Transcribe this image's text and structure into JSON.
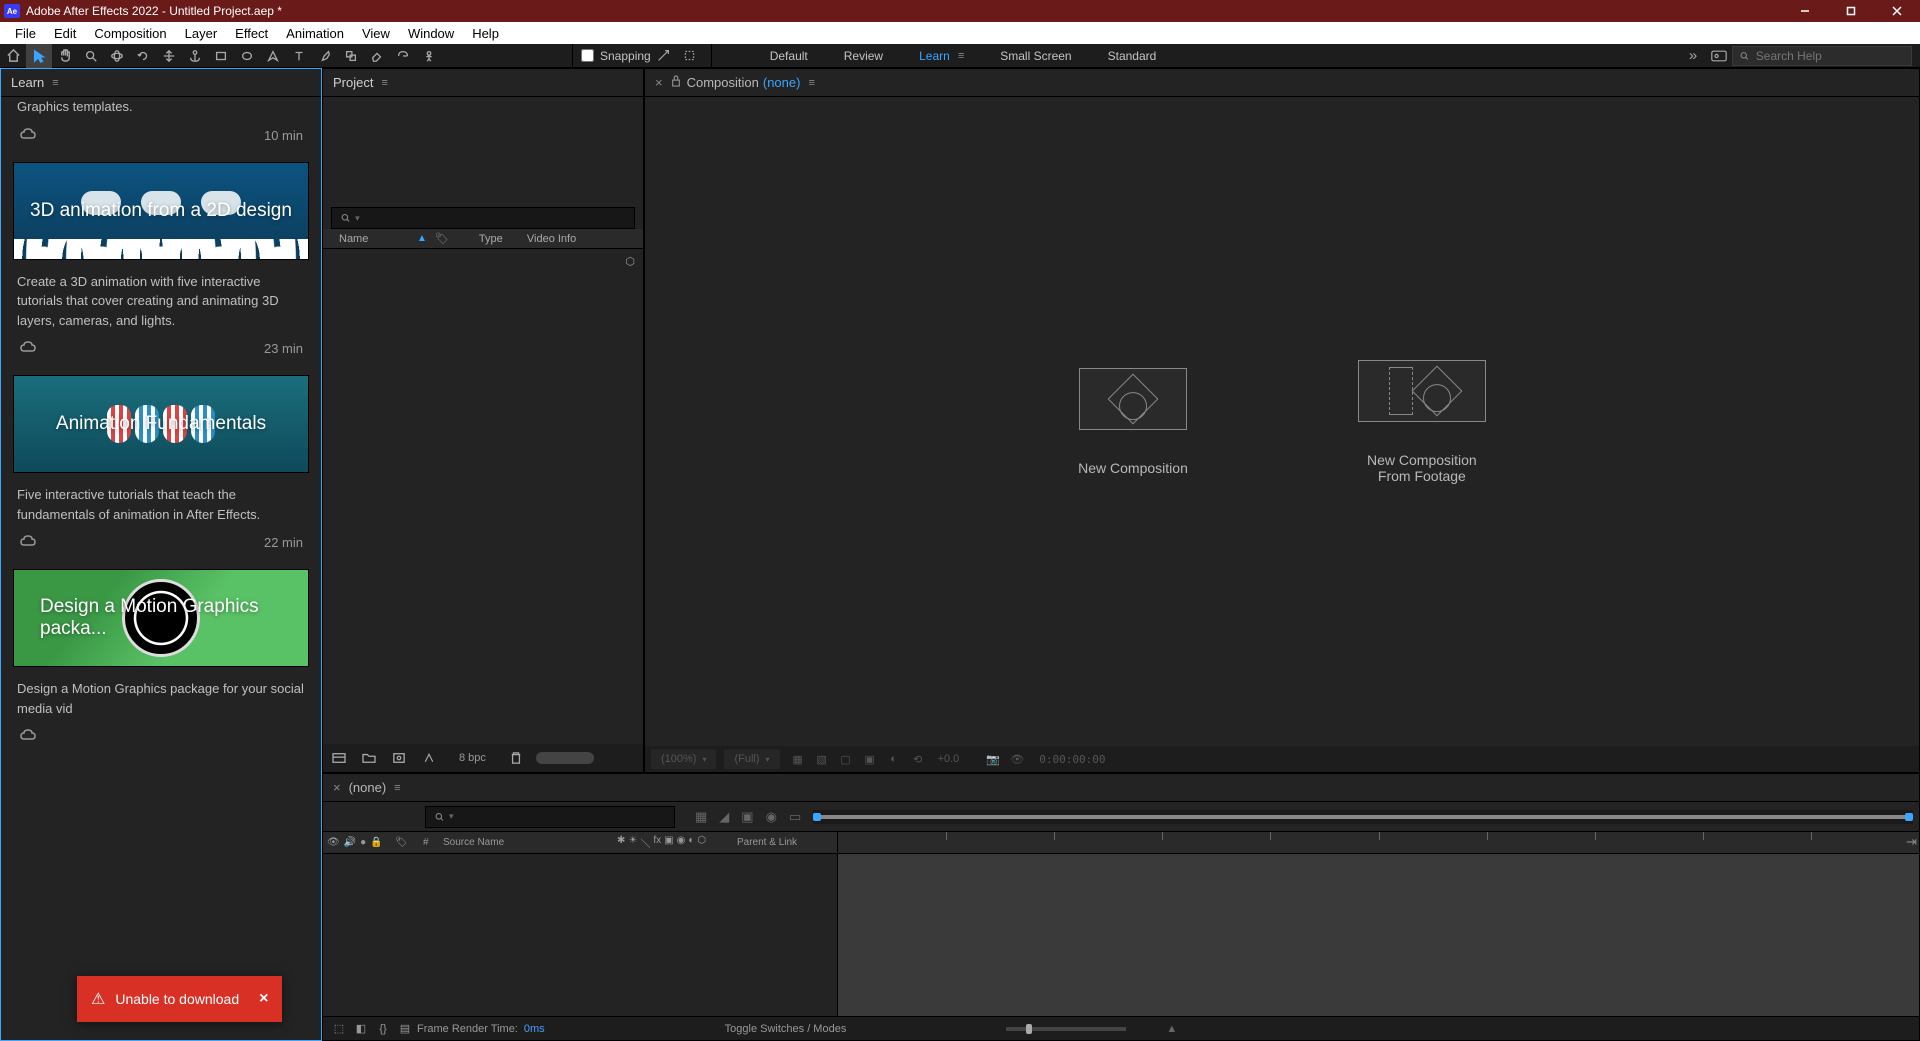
{
  "titlebar": {
    "app_icon": "Ae",
    "title": "Adobe After Effects 2022 - Untitled Project.aep *"
  },
  "menubar": [
    "File",
    "Edit",
    "Composition",
    "Layer",
    "Effect",
    "Animation",
    "View",
    "Window",
    "Help"
  ],
  "toolbar": {
    "snapping_label": "Snapping",
    "workspaces": [
      "Default",
      "Review",
      "Learn",
      "Small Screen",
      "Standard"
    ],
    "active_workspace": "Learn",
    "search_placeholder": "Search Help"
  },
  "learn": {
    "tab": "Learn",
    "partial_line": "Graphics templates.",
    "partial_time": "10 min",
    "tutorials": [
      {
        "title": "3D animation from a 2D design",
        "desc": "Create a 3D animation with five interactive tutorials that cover creating and animating 3D layers, cameras, and lights.",
        "duration": "23 min",
        "thumb_style": "blue"
      },
      {
        "title": "Animation Fundamentals",
        "desc": "Five interactive tutorials that teach the fundamentals of animation in After Effects.",
        "duration": "22 min",
        "thumb_style": "teal"
      },
      {
        "title": "Design a Motion Graphics packa...",
        "desc": "Design a Motion Graphics package for your social media vid",
        "duration": "",
        "thumb_style": "pink"
      }
    ]
  },
  "toast": {
    "message": "Unable to download"
  },
  "project": {
    "tab": "Project",
    "cols": {
      "name": "Name",
      "type": "Type",
      "info": "Video Info"
    },
    "bpc": "8 bpc"
  },
  "composition": {
    "tab_label": "Composition",
    "none": "(none)",
    "new_comp": "New Composition",
    "new_comp_footage_l1": "New Composition",
    "new_comp_footage_l2": "From Footage",
    "footer": {
      "zoom": "(100%)",
      "res": "(Full)",
      "exposure": "+0.0",
      "timecode": "0:00:00:00"
    }
  },
  "timeline": {
    "none": "(none)",
    "cols": {
      "hash": "#",
      "source": "Source Name",
      "parent": "Parent & Link"
    },
    "footer": {
      "frt_label": "Frame Render Time:",
      "frt_value": "0ms",
      "toggle": "Toggle Switches / Modes"
    }
  }
}
